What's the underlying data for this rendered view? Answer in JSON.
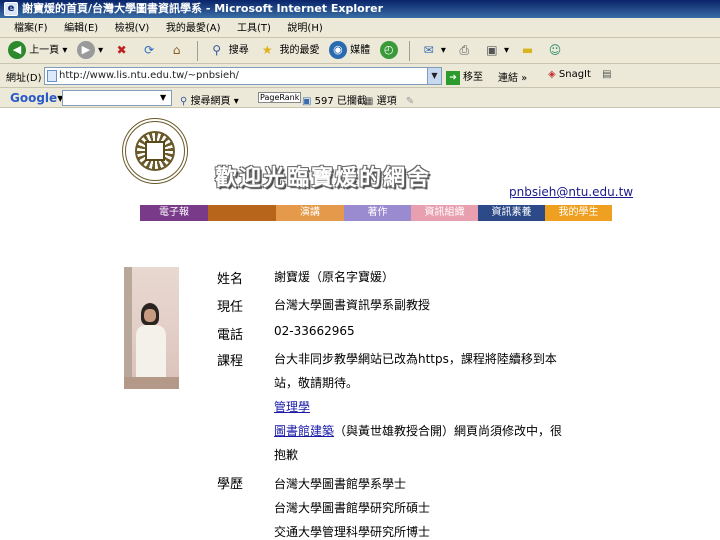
{
  "window": {
    "title": "謝寶煖的首頁/台灣大學圖書資訊學系 - Microsoft Internet Explorer"
  },
  "menu": [
    "檔案(F)",
    "編輯(E)",
    "檢視(V)",
    "我的最愛(A)",
    "工具(T)",
    "說明(H)"
  ],
  "toolbar": {
    "back_label": "上一頁",
    "search_label": "搜尋",
    "favorites_label": "我的最愛",
    "media_label": "媒體"
  },
  "address": {
    "label": "網址(D)",
    "url": "http://www.lis.ntu.edu.tw/~pnbsieh/",
    "go_label": "移至",
    "links_label": "連結",
    "snagit_label": "SnagIt"
  },
  "googlebar": {
    "logo": "Google",
    "search_web": "搜尋網頁",
    "pagerank": "PageRank",
    "blocked": "597 已攔截",
    "options": "選項"
  },
  "page": {
    "banner_title": "歡迎光臨寶煖的網舍",
    "email": "pnbsieh@ntu.edu.tw",
    "nav": [
      {
        "label": "電子報",
        "color": "#7a3a8a"
      },
      {
        "label": "",
        "color": "#b8651c"
      },
      {
        "label": "演講",
        "color": "#e49a4a"
      },
      {
        "label": "著作",
        "color": "#9a8ad0"
      },
      {
        "label": "資訊組織",
        "color": "#e8a0b0"
      },
      {
        "label": "資訊素養",
        "color": "#2c4a88"
      },
      {
        "label": "我的學生",
        "color": "#f0a020"
      }
    ],
    "name_label": "姓名",
    "name_value": "謝寶煖（原名字寶媛）",
    "position_label": "現任",
    "position_value": "台灣大學圖書資訊學系副教授",
    "phone_label": "電話",
    "phone_value": "02-33662965",
    "courses_label": "課程",
    "courses_line1": "台大非同步教學網站已改為https，課程將陸續移到本",
    "courses_line2": "站，敬請期待。",
    "course_1": "管理學",
    "course_2": "圖書館建築",
    "course_2_note": "（與黃世雄教授合開）網頁尚須修改中，很",
    "course_2_note_line2": "抱歉",
    "education_label": "學歷",
    "education": [
      "台灣大學圖書館學系學士",
      "台灣大學圖書館學研究所碩士",
      "交通大學管理科學研究所博士"
    ]
  }
}
